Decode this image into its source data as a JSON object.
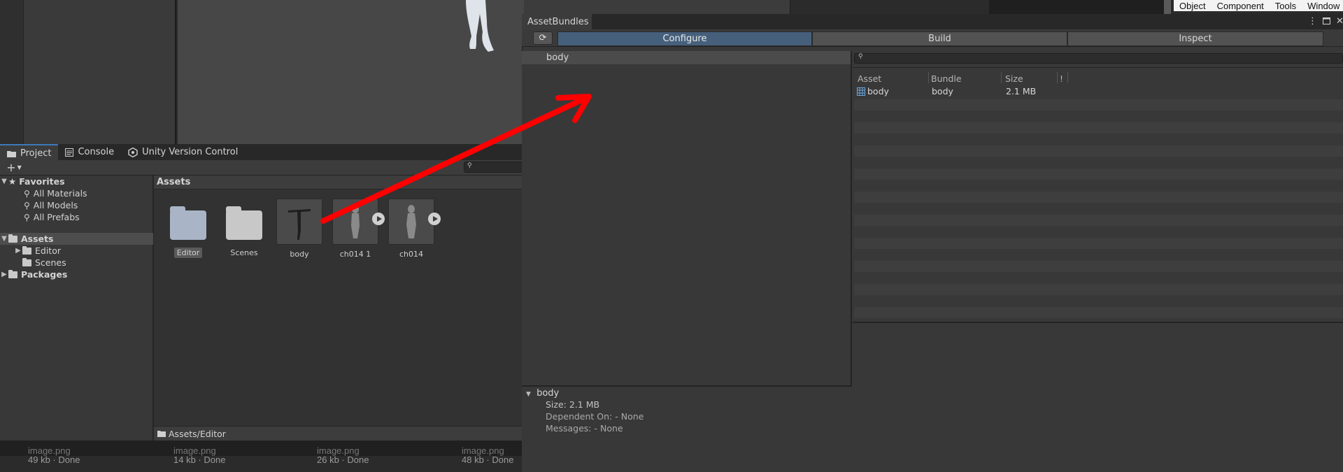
{
  "menu": {
    "items": [
      "Object",
      "Component",
      "Tools",
      "Window"
    ]
  },
  "project": {
    "tabs": [
      {
        "label": "Project",
        "icon": "folder-icon"
      },
      {
        "label": "Console",
        "icon": "console-icon"
      },
      {
        "label": "Unity Version Control",
        "icon": "version-control-icon"
      }
    ],
    "add_label": "+",
    "tree": {
      "favorites": "Favorites",
      "fav_items": [
        "All Materials",
        "All Models",
        "All Prefabs"
      ],
      "assets": "Assets",
      "asset_children": [
        "Editor",
        "Scenes"
      ],
      "packages": "Packages"
    },
    "assets_header": "Assets",
    "items": [
      {
        "label": "Editor",
        "kind": "folder-icon"
      },
      {
        "label": "Scenes",
        "kind": "folder-icon"
      },
      {
        "label": "body",
        "kind": "model-thumbnail"
      },
      {
        "label": "ch014 1",
        "kind": "model-thumbnail"
      },
      {
        "label": "ch014",
        "kind": "model-thumbnail"
      }
    ],
    "path": "Assets/Editor"
  },
  "downloads": [
    {
      "name": "image.png",
      "status": "49 kb · Done"
    },
    {
      "name": "image.png",
      "status": "14 kb · Done"
    },
    {
      "name": "image.png",
      "status": "26 kb · Done"
    },
    {
      "name": "image.png",
      "status": "48 kb · Done"
    }
  ],
  "assetbundles": {
    "title": "AssetBundles",
    "tabs": {
      "configure": "Configure",
      "build": "Build",
      "inspect": "Inspect"
    },
    "active_tab": "Configure",
    "bundles": [
      "body"
    ],
    "detail": {
      "name": "body",
      "size": "Size: 2.1 MB",
      "dependent": "Dependent On: - None",
      "messages": "Messages: - None"
    },
    "table": {
      "headers": {
        "asset": "Asset",
        "bundle": "Bundle",
        "size": "Size",
        "flag": "!"
      },
      "rows": [
        {
          "asset": "body",
          "bundle": "body",
          "size": "2.1 MB"
        }
      ]
    }
  },
  "colors": {
    "accent": "#3a79bb",
    "active_tab": "#46607c",
    "annotation": "#ff0000"
  }
}
